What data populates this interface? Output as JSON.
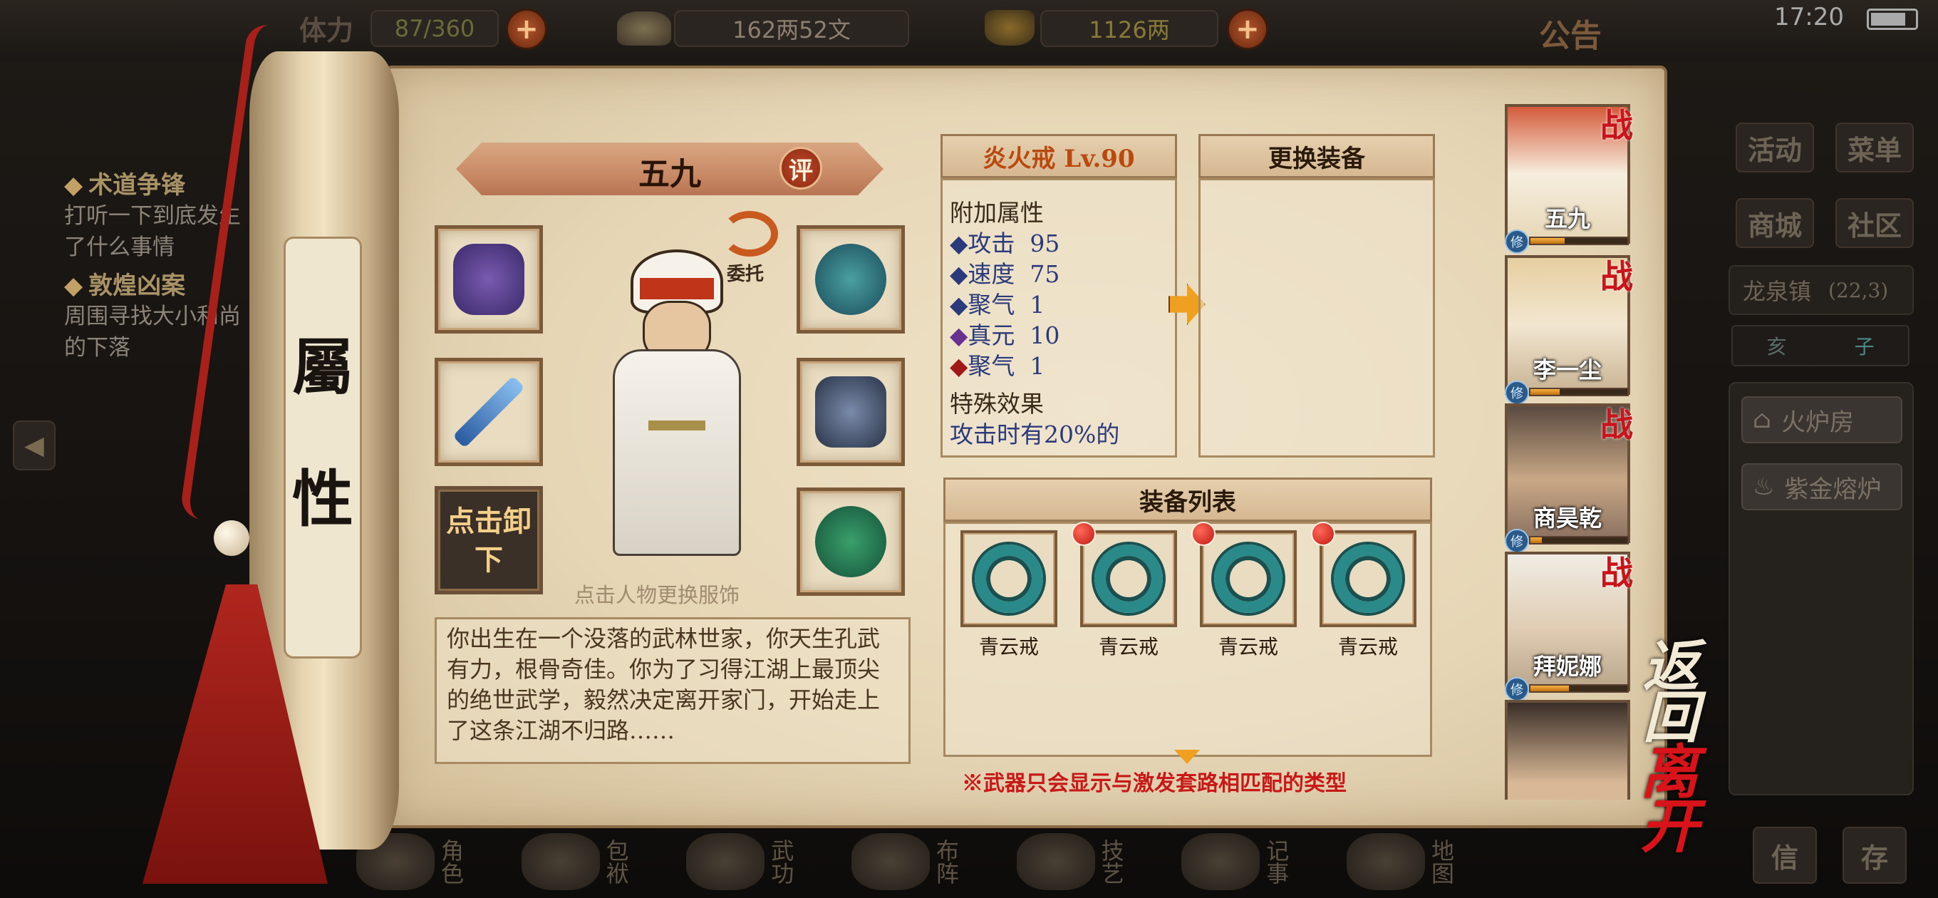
{
  "status_bar": {
    "time": "17:20"
  },
  "top": {
    "stamina_label": "体力",
    "stamina": "87/360",
    "silver": "162两52文",
    "gold": "1126两",
    "notice": "公告"
  },
  "quests": [
    {
      "title": "术道争锋",
      "desc": "打听一下到底发生了什么事情"
    },
    {
      "title": "敦煌凶案",
      "desc": "周围寻找大小和尚的下落"
    }
  ],
  "right_menu": {
    "activity": "活动",
    "menu": "菜单",
    "shop": "商城",
    "community": "社区",
    "location": "龙泉镇",
    "coords": "(22,3)",
    "time_of_day": "亥",
    "time_next": "子",
    "furnace_room": "火炉房",
    "gold_furnace": "紫金熔炉",
    "letter": "信",
    "save": "存"
  },
  "scroll_tab": {
    "char1": "屬",
    "char2": "性"
  },
  "character": {
    "name": "五九",
    "rate_badge": "评",
    "delegate": "委托",
    "unequip": "点击卸下",
    "change_outfit_hint": "点击人物更换服饰",
    "description": "你出生在一个没落的武林世家，你天生孔武有力，根骨奇佳。你为了习得江湖上最顶尖的绝世武学，毅然决定离开家门，开始走上了这条江湖不归路……"
  },
  "current_item": {
    "title": "炎火戒 Lv.90",
    "section_attrs": "附加属性",
    "attrs": [
      {
        "name": "攻击",
        "value": "95",
        "tone": "blue"
      },
      {
        "name": "速度",
        "value": "75",
        "tone": "blue"
      },
      {
        "name": "聚气",
        "value": "1",
        "tone": "blue"
      },
      {
        "name": "真元",
        "value": "10",
        "tone": "purple"
      },
      {
        "name": "聚气",
        "value": "1",
        "tone": "red"
      }
    ],
    "section_special": "特殊效果",
    "special": "攻击时有20%的"
  },
  "replace_panel": {
    "title": "更换装备"
  },
  "equip_list": {
    "title": "装备列表",
    "items": [
      {
        "name": "青云戒",
        "new": false
      },
      {
        "name": "青云戒",
        "new": true
      },
      {
        "name": "青云戒",
        "new": true
      },
      {
        "name": "青云戒",
        "new": true
      }
    ],
    "note": "※武器只会显示与激发套路相匹配的类型"
  },
  "party": [
    {
      "name": "五九",
      "badge": "战",
      "xiu": "修",
      "xp": 0.35
    },
    {
      "name": "李一尘",
      "badge": "战",
      "xiu": "修",
      "xp": 0.3
    },
    {
      "name": "商昊乾",
      "badge": "战",
      "xiu": "修",
      "xp": 0.12
    },
    {
      "name": "拜妮娜",
      "badge": "战",
      "xiu": "修",
      "xp": 0.4
    },
    {
      "name": "",
      "badge": "",
      "xiu": "",
      "xp": 0
    }
  ],
  "actions": {
    "back": "返回",
    "leave": "离开"
  },
  "bottom_nav": [
    "角色",
    "包袱",
    "武功",
    "布阵",
    "技艺",
    "记事",
    "地图"
  ],
  "colors": {
    "accent_orange": "#e8782a",
    "title_red": "#c8141a",
    "item_orange": "#b84a10"
  }
}
